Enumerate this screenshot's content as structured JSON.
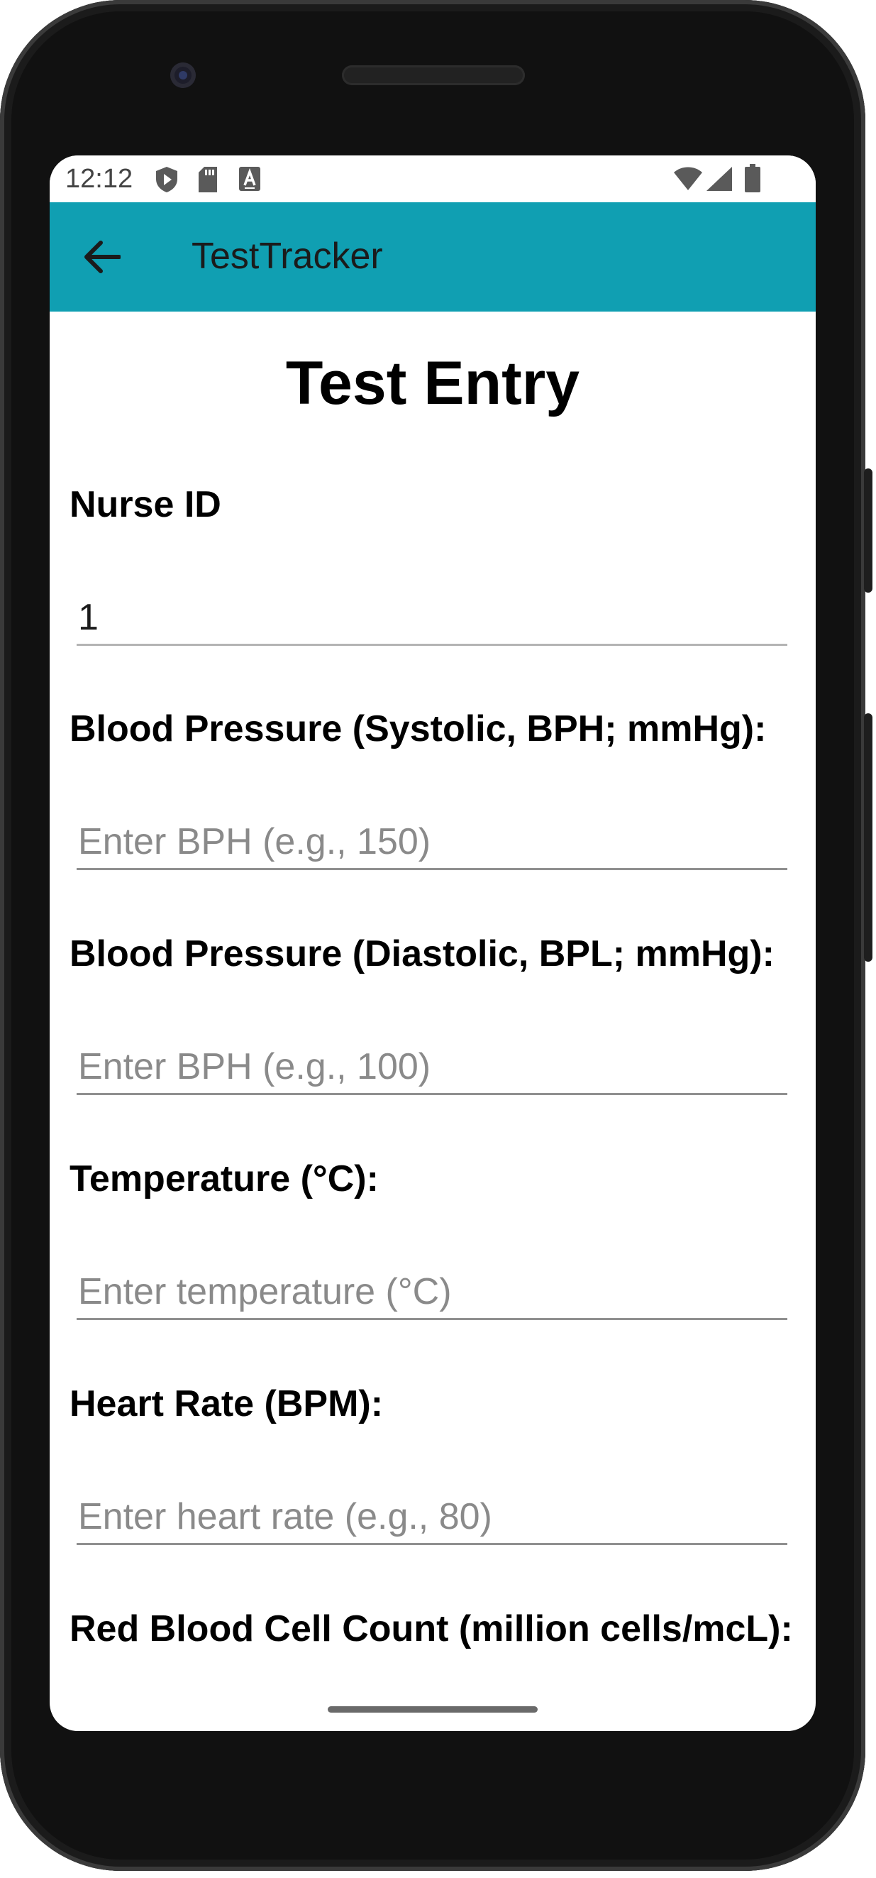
{
  "status_bar": {
    "time": "12:12",
    "left_icons": [
      "shield-play-icon",
      "sd-card-icon",
      "keyboard-a-icon"
    ],
    "right_icons": [
      "wifi-icon",
      "cell-signal-icon",
      "battery-icon"
    ]
  },
  "app_bar": {
    "title": "TestTracker",
    "background_color": "#109fb2",
    "back_icon": "arrow-back-icon"
  },
  "page": {
    "title": "Test Entry"
  },
  "form": {
    "nurse_id": {
      "label": "Nurse ID",
      "value": "1",
      "placeholder": ""
    },
    "systolic": {
      "label": "Blood Pressure (Systolic, BPH; mmHg):",
      "value": "",
      "placeholder": "Enter BPH (e.g., 150)"
    },
    "diastolic": {
      "label": "Blood Pressure (Diastolic, BPL; mmHg):",
      "value": "",
      "placeholder": "Enter BPH (e.g., 100)"
    },
    "temperature": {
      "label": "Temperature (°C):",
      "value": "",
      "placeholder": "Enter temperature (°C)"
    },
    "heart_rate": {
      "label": "Heart Rate (BPM):",
      "value": "",
      "placeholder": "Enter heart rate (e.g., 80)"
    },
    "rbc_count": {
      "label": "Red Blood Cell Count (million cells/mcL):"
    }
  }
}
